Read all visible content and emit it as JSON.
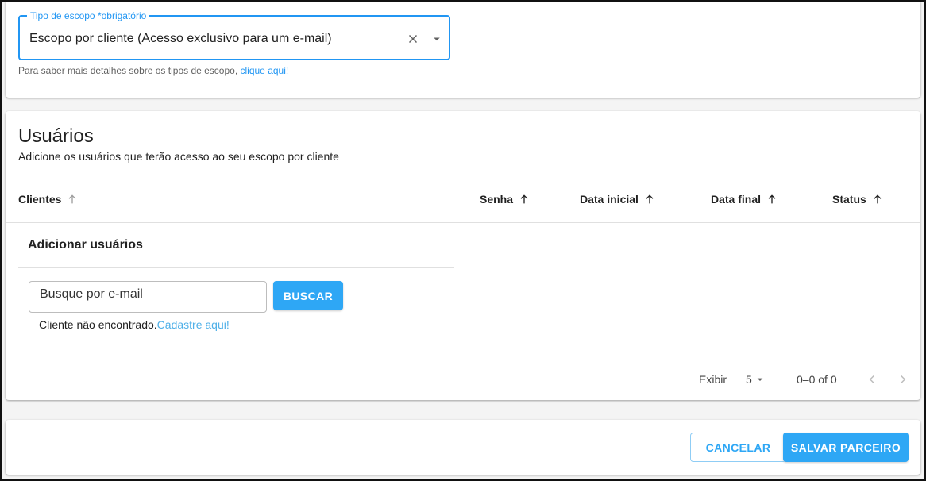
{
  "scope": {
    "label": "Tipo de escopo *obrigatório",
    "value": "Escopo por cliente (Acesso exclusivo para um e-mail)",
    "helper_text": "Para saber mais detalhes sobre os tipos de escopo, ",
    "helper_link": "clique aqui!"
  },
  "users": {
    "title": "Usuários",
    "subtitle": "Adicione os usuários que terão acesso ao seu escopo por cliente",
    "columns": [
      "Clientes",
      "Senha",
      "Data inicial",
      "Data final",
      "Status"
    ],
    "add_title": "Adicionar usuários",
    "search_placeholder": "Busque por e-mail",
    "search_button": "BUSCAR",
    "not_found_text": "Cliente não encontrado.",
    "not_found_link": "Cadastre aqui!"
  },
  "pagination": {
    "label": "Exibir",
    "page_size": "5",
    "range": "0–0 of 0"
  },
  "actions": {
    "cancel": "CANCELAR",
    "save": "SALVAR PARCEIRO"
  },
  "colors": {
    "accent": "#2196f3",
    "button": "#2ea7f5",
    "link_light": "#4fb0e8"
  },
  "icons": [
    "close-icon",
    "arrow-drop-down-icon",
    "arrow-up-icon",
    "chevron-left-icon",
    "chevron-right-icon"
  ]
}
